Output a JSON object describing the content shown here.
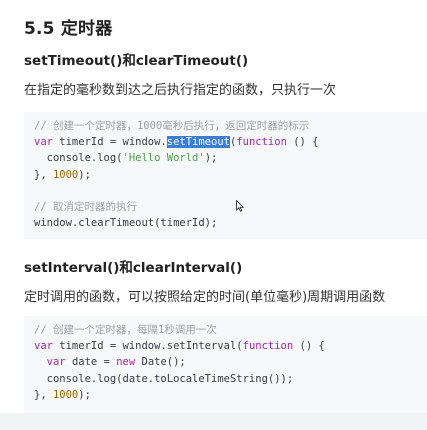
{
  "section_title": "5.5 定时器",
  "subsections": [
    {
      "heading": "setTimeout()和clearTimeout()",
      "description": "在指定的毫秒数到达之后执行指定的函数，只执行一次",
      "code": {
        "l1": "// 创建一个定时器，1000毫秒后执行，返回定时器的标示",
        "l2_a": "var",
        "l2_b": " timerId = window.",
        "l2_sel": "setTimeout",
        "l2_c": "(",
        "l2_d": "function",
        "l2_e": " () {",
        "l3_a": "  console.log(",
        "l3_b": "'Hello World'",
        "l3_c": ");",
        "l4_a": "}, ",
        "l4_b": "1000",
        "l4_c": ");",
        "l6": "// 取消定时器的执行",
        "l7": "window.clearTimeout(timerId);"
      }
    },
    {
      "heading": "setInterval()和clearInterval()",
      "description": "定时调用的函数，可以按照给定的时间(单位毫秒)周期调用函数",
      "code": {
        "l1": "// 创建一个定时器，每隔1秒调用一次",
        "l2_a": "var",
        "l2_b": " timerId = window.setInterval(",
        "l2_c": "function",
        "l2_d": " () {",
        "l3_a": "  ",
        "l3_b": "var",
        "l3_c": " date = ",
        "l3_d": "new",
        "l3_e": " Date();",
        "l4": "  console.log(date.toLocaleTimeString());",
        "l5_a": "}, ",
        "l5_b": "1000",
        "l5_c": ");"
      }
    }
  ],
  "colors": {
    "code_background": "#f6f8fa",
    "comment": "#a0a1a7",
    "keyword": "#a626a4",
    "string": "#50a14f",
    "number": "#986801",
    "selection": "#3b7ed8"
  },
  "icons": [
    "mouse-cursor-icon"
  ]
}
